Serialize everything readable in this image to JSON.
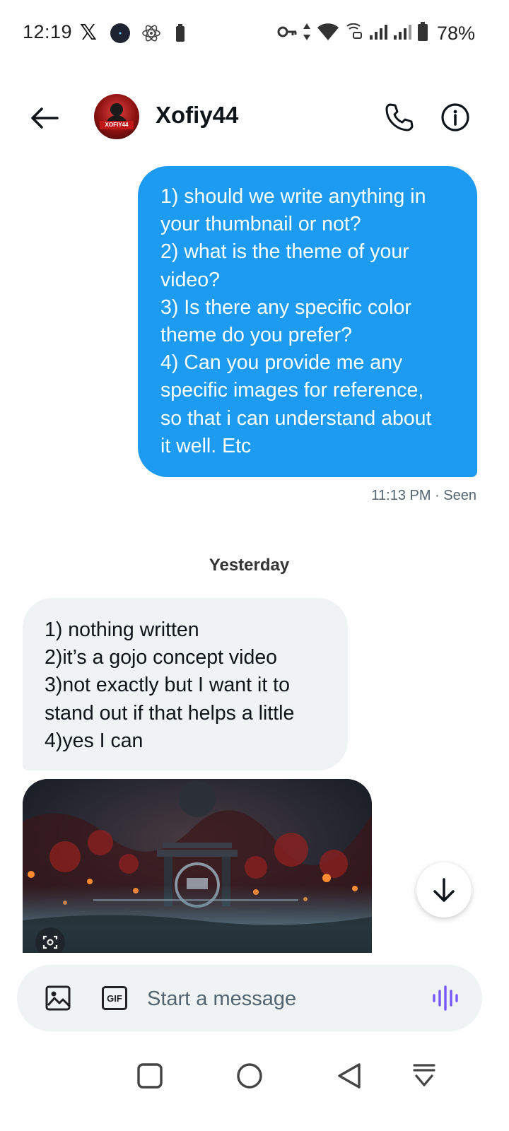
{
  "status_bar": {
    "time": "12:19",
    "battery_percent": "78%",
    "icons": [
      "x-logo-icon",
      "vryco-icon",
      "react-icon",
      "battery-small-icon",
      "vpn-key-icon",
      "data-arrows-icon",
      "wifi-icon",
      "wifi-calling-icon",
      "signal-1-icon",
      "signal-2-icon",
      "battery-icon"
    ]
  },
  "header": {
    "contact_name": "Xofiy44",
    "avatar_label": "XOFIY44",
    "icons": [
      "back-arrow-icon",
      "phone-icon",
      "info-icon"
    ]
  },
  "messages": {
    "sent_text": "1) should we write anything in\nyour thumbnail or not?\n2) what is the theme of your\nvideo?\n3) Is there any specific color\ntheme do you prefer?\n4) Can you provide me any\nspecific images for reference,\nso that i can understand about\nit well. Etc",
    "sent_time": "11:13 PM",
    "sent_status": "Seen",
    "date_separator": "Yesterday",
    "received_text": "1) nothing written\n2)it’s a gojo concept video\n3)not exactly but I want it to\nstand out if that helps a little\n4)yes I can"
  },
  "composer": {
    "placeholder": "Start a message",
    "gif_label": "GIF"
  },
  "colors": {
    "accent": "#1d9bf0",
    "received_bubble": "#eff3f4",
    "voice_icon": "#7856ff"
  }
}
